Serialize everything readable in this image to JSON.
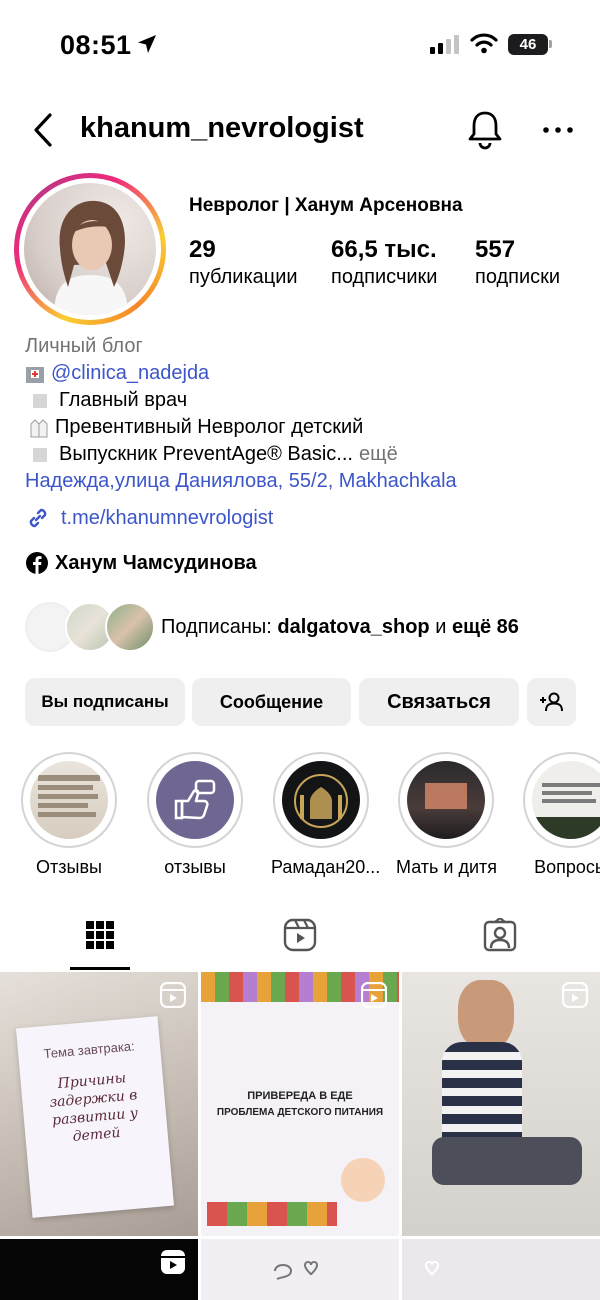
{
  "status_bar": {
    "time": "08:51",
    "battery": "46"
  },
  "header": {
    "username": "khanum_nevrologist"
  },
  "profile": {
    "display_name": "Невролог | Ханум Арсеновна",
    "stats": [
      {
        "value": "29",
        "label": "публикации"
      },
      {
        "value": "66,5 тыс.",
        "label": "подписчики"
      },
      {
        "value": "557",
        "label": "подписки"
      }
    ],
    "category": "Личный блог",
    "bio": {
      "clinic_link": "@clinica_nadejda",
      "line2": "Главный врач",
      "line3": "Превентивный Невролог детский",
      "line4": "Выпускник PreventAge® Basic...",
      "more": "ещё",
      "address": "Надежда,улица Даниялова, 55/2, Makhachkala"
    },
    "external_link": "t.me/khanumnevrologist",
    "facebook_name": "Ханум Чамсудинова",
    "followed_by": {
      "prefix": "Подписаны: ",
      "user": "dalgatova_shop",
      "middle": " и ",
      "rest": "ещё 86"
    }
  },
  "actions": {
    "following": "Вы подписаны",
    "message": "Сообщение",
    "contact": "Связаться"
  },
  "highlights": [
    {
      "label": "Отзывы"
    },
    {
      "label": "отзывы"
    },
    {
      "label": "Рамадан20..."
    },
    {
      "label": "Мать и дитя"
    },
    {
      "label": "Вопросы"
    }
  ],
  "grid": {
    "post1": {
      "title": "Тема завтрака:",
      "headline": "Причины задержки в развитии у детей"
    },
    "post2": {
      "line1": "ПРИВЕРЕДА В ЕДЕ",
      "line2": "ПРОБЛЕМА ДЕТСКОГО ПИТАНИЯ"
    }
  },
  "colors": {
    "link": "#3c55c9",
    "button_bg": "#efefef",
    "muted": "#737373"
  }
}
